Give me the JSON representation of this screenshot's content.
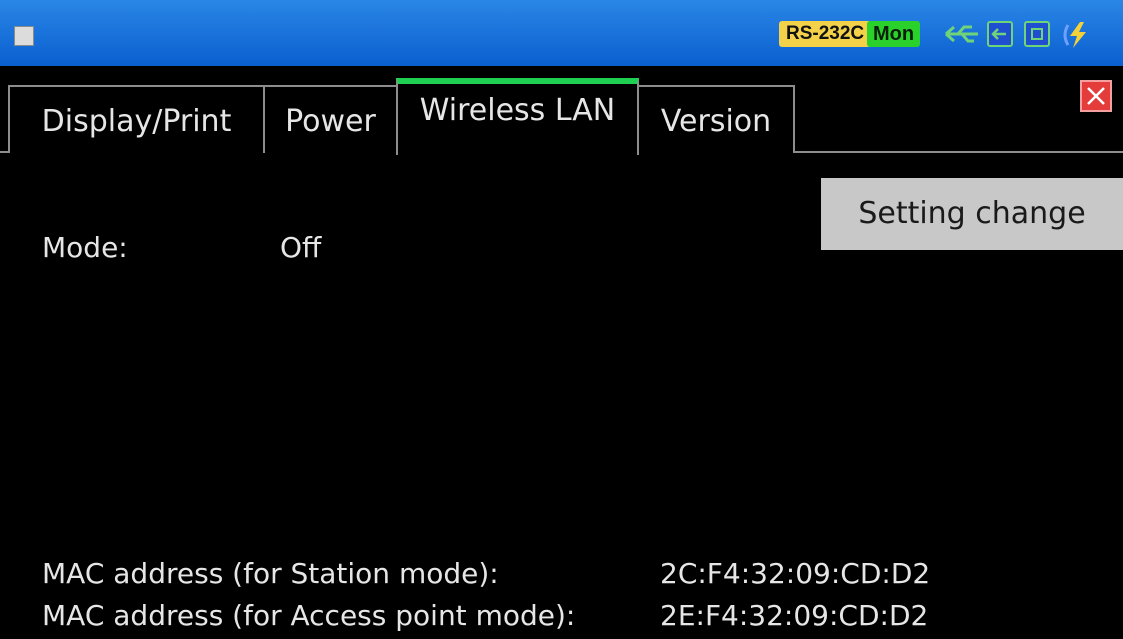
{
  "status_bar": {
    "interface": "RS-232C",
    "mode": "Mon",
    "icons": [
      "menu-icon",
      "usb-icon",
      "input-icon",
      "memory-card-icon",
      "power-icon"
    ]
  },
  "tabs": [
    {
      "label": "Display/Print",
      "active": false
    },
    {
      "label": "Power",
      "active": false
    },
    {
      "label": "Wireless LAN",
      "active": true
    },
    {
      "label": "Version",
      "active": false
    }
  ],
  "actions": {
    "setting_change": "Setting change"
  },
  "wireless": {
    "mode_label": "Mode:",
    "mode_value": "Off",
    "mac_station_label": "MAC address (for Station mode):",
    "mac_station_value": "2C:F4:32:09:CD:D2",
    "mac_ap_label": "MAC address (for Access point mode):",
    "mac_ap_value": "2E:F4:32:09:CD:D2"
  },
  "colors": {
    "status_bar": "#0a6ad8",
    "active_tab_accent": "#1fcf52",
    "background": "#000000",
    "close": "#e43b3b"
  }
}
